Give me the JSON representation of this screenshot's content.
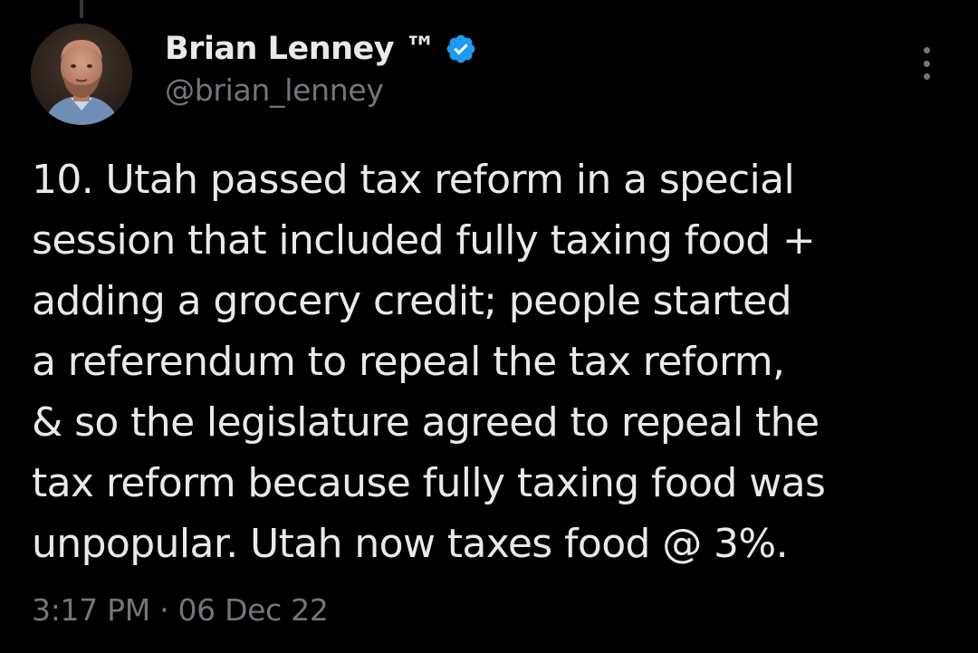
{
  "author": {
    "display_name": "Brian Lenney ™",
    "handle": "@brian_lenney",
    "verified": true
  },
  "tweet": {
    "lines": [
      "10. Utah passed tax reform in a special",
      "session that included fully taxing food +",
      "adding a grocery credit; people started",
      "a referendum to repeal the tax reform,",
      "& so the legislature agreed to repeal the",
      "tax reform because fully taxing food was",
      "unpopular. Utah now taxes food @ 3%."
    ],
    "time": "3:17 PM",
    "separator": "·",
    "date": "06 Dec 22"
  },
  "icons": {
    "verified": "verified-badge-icon",
    "more": "more-options-icon"
  },
  "colors": {
    "background": "#000000",
    "primary_text": "#e7e9ea",
    "secondary_text": "#71767b",
    "verified_blue": "#1d9bf0"
  }
}
